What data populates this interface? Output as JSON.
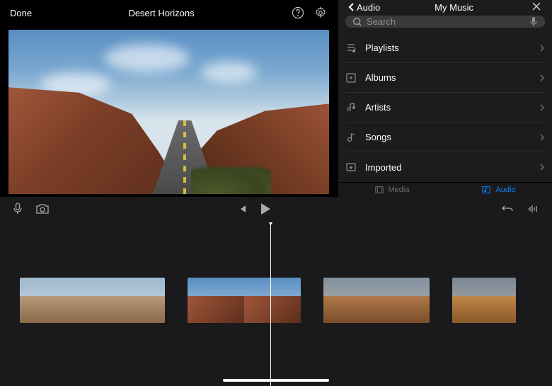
{
  "header": {
    "done_label": "Done",
    "project_title": "Desert Horizons"
  },
  "panel": {
    "back_label": "Audio",
    "title": "My Music",
    "search_placeholder": "Search",
    "items": [
      {
        "label": "Playlists",
        "icon": "playlist-icon"
      },
      {
        "label": "Albums",
        "icon": "album-icon"
      },
      {
        "label": "Artists",
        "icon": "artist-icon"
      },
      {
        "label": "Songs",
        "icon": "song-icon"
      },
      {
        "label": "Imported",
        "icon": "imported-icon"
      }
    ]
  },
  "tabs": {
    "media_label": "Media",
    "audio_label": "Audio",
    "active": "audio"
  },
  "colors": {
    "accent": "#0a84ff",
    "panel_bg": "#1c1c1e",
    "search_bg": "#3a3a3c"
  }
}
